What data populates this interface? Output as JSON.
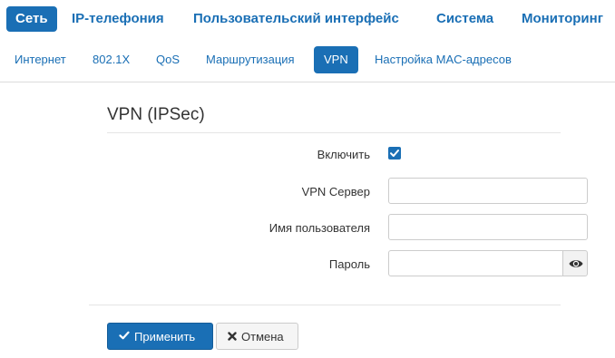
{
  "top_nav": {
    "items": [
      {
        "label": "Сеть",
        "active": true
      },
      {
        "label": "IP-телефония",
        "active": false
      },
      {
        "label": "Пользовательский интерфейс",
        "active": false
      },
      {
        "label": "Система",
        "active": false
      },
      {
        "label": "Мониторинг",
        "active": false
      }
    ]
  },
  "sub_nav": {
    "items": [
      {
        "label": "Интернет",
        "active": false
      },
      {
        "label": "802.1X",
        "active": false
      },
      {
        "label": "QoS",
        "active": false
      },
      {
        "label": "Маршрутизация",
        "active": false
      },
      {
        "label": "VPN",
        "active": true
      },
      {
        "label": "Настройка MAC-адресов",
        "active": false
      }
    ]
  },
  "form": {
    "title": "VPN (IPSec)",
    "enable_label": "Включить",
    "enable_checked": true,
    "server_label": "VPN Сервер",
    "server_value": "",
    "username_label": "Имя пользователя",
    "username_value": "",
    "password_label": "Пароль",
    "password_value": ""
  },
  "actions": {
    "apply_label": "Применить",
    "cancel_label": "Отмена"
  },
  "colors": {
    "accent": "#1a6fb5"
  }
}
